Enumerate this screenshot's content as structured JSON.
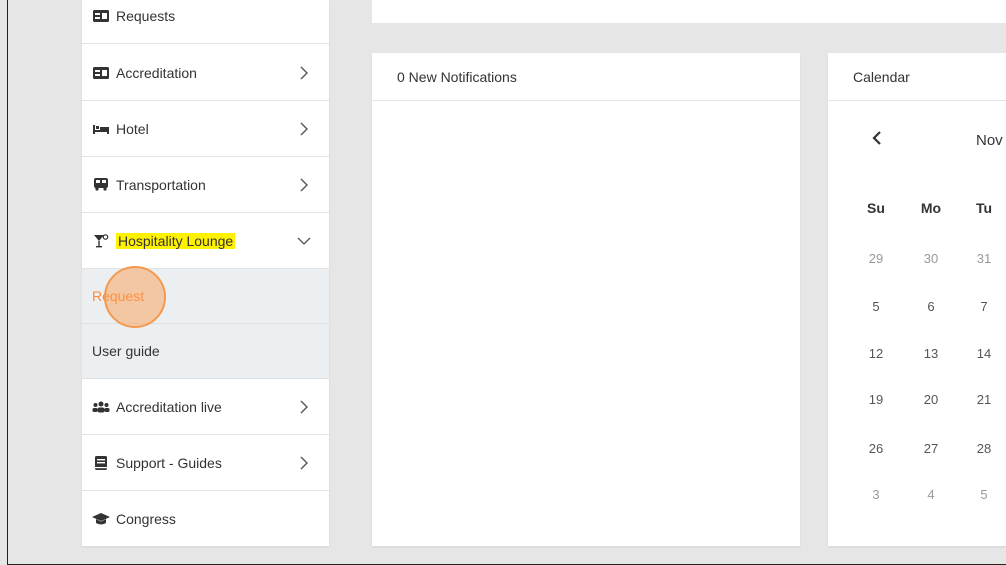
{
  "sidebar": {
    "items": [
      {
        "label": "Requests",
        "icon": "id-card-icon"
      },
      {
        "label": "Accreditation",
        "icon": "id-card-icon"
      },
      {
        "label": "Hotel",
        "icon": "bed-icon"
      },
      {
        "label": "Transportation",
        "icon": "bus-icon"
      },
      {
        "label": "Hospitality Lounge",
        "icon": "cocktail-icon"
      },
      {
        "label": "Accreditation live",
        "icon": "users-icon"
      },
      {
        "label": "Support - Guides",
        "icon": "book-icon"
      },
      {
        "label": "Congress",
        "icon": "graduation-cap-icon"
      }
    ],
    "subitems": [
      {
        "label": "Request"
      },
      {
        "label": "User guide"
      }
    ]
  },
  "notifications": {
    "title": "0 New Notifications"
  },
  "calendar": {
    "title": "Calendar",
    "month_partial": "Nov",
    "weekdays": [
      "Su",
      "Mo",
      "Tu"
    ],
    "weeks": [
      [
        "29",
        "30",
        "31"
      ],
      [
        "5",
        "6",
        "7"
      ],
      [
        "12",
        "13",
        "14"
      ],
      [
        "19",
        "20",
        "21"
      ],
      [
        "26",
        "27",
        "28"
      ],
      [
        "3",
        "4",
        "5"
      ]
    ]
  },
  "colors": {
    "accent": "#ff8a3d",
    "highlight": "#fff200"
  }
}
